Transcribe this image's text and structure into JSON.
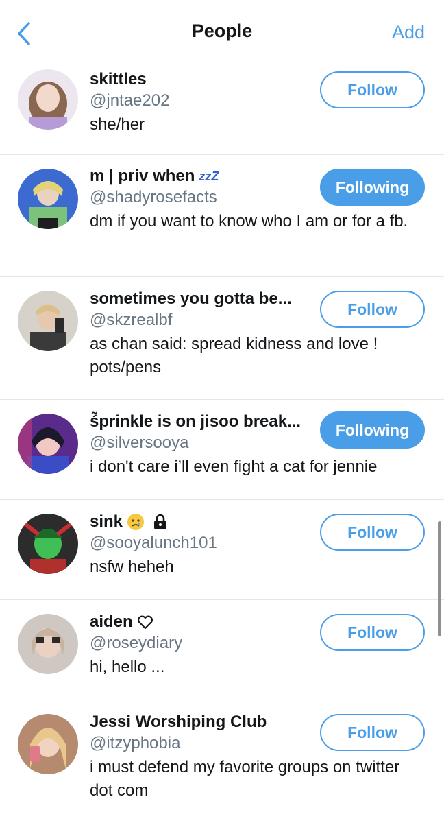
{
  "nav": {
    "title": "People",
    "add_label": "Add"
  },
  "people": [
    {
      "name": "skittles",
      "handle": "@jntae202",
      "bio": "she/her",
      "button": "Follow"
    },
    {
      "name": "m | priv when",
      "name_suffix": "zzZ",
      "handle": "@shadyrosefacts",
      "bio": "dm if you want to know who I am or for a fb.",
      "button": "Following"
    },
    {
      "name": "sometimes you gotta be...",
      "handle": "@skzrealbf",
      "bio": "as chan said: spread kidness and love ! pots/pens",
      "button": "Follow"
    },
    {
      "name": "ś̃prinkle is on jisoo break...",
      "handle": "@silversooya",
      "bio": "i don't care i’ll even fight a cat for jennie",
      "button": "Following"
    },
    {
      "name": "sink",
      "handle": "@sooyalunch101",
      "bio": "nsfw heheh",
      "button": "Follow"
    },
    {
      "name": "aiden",
      "handle": "@roseydiary",
      "bio": "hi, hello ...",
      "button": "Follow"
    },
    {
      "name": "Jessi Worshiping Club",
      "handle": "@itzyphobia",
      "bio": "i must defend my favorite groups on twitter dot com",
      "button": "Follow"
    }
  ],
  "colors": {
    "accent": "#4a9ee8",
    "handle": "#687684",
    "divider": "#e1e8ed"
  },
  "icons": [
    "back-chevron-icon",
    "sleeping-zzz-icon",
    "crying-face-emoji",
    "lock-icon",
    "heart-outline-icon"
  ]
}
